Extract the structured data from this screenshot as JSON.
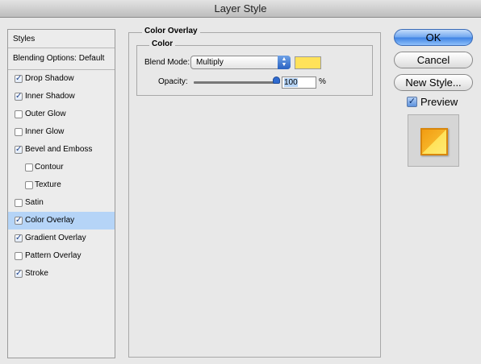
{
  "window": {
    "title": "Layer Style"
  },
  "sidebar": {
    "header": "Styles",
    "blending_options": "Blending Options: Default",
    "items": [
      {
        "label": "Drop Shadow",
        "checked": true,
        "indent": false,
        "selected": false
      },
      {
        "label": "Inner Shadow",
        "checked": true,
        "indent": false,
        "selected": false
      },
      {
        "label": "Outer Glow",
        "checked": false,
        "indent": false,
        "selected": false
      },
      {
        "label": "Inner Glow",
        "checked": false,
        "indent": false,
        "selected": false
      },
      {
        "label": "Bevel and Emboss",
        "checked": true,
        "indent": false,
        "selected": false
      },
      {
        "label": "Contour",
        "checked": false,
        "indent": true,
        "selected": false
      },
      {
        "label": "Texture",
        "checked": false,
        "indent": true,
        "selected": false
      },
      {
        "label": "Satin",
        "checked": false,
        "indent": false,
        "selected": false
      },
      {
        "label": "Color Overlay",
        "checked": true,
        "indent": false,
        "selected": true
      },
      {
        "label": "Gradient Overlay",
        "checked": true,
        "indent": false,
        "selected": false
      },
      {
        "label": "Pattern Overlay",
        "checked": false,
        "indent": false,
        "selected": false
      },
      {
        "label": "Stroke",
        "checked": true,
        "indent": false,
        "selected": false
      }
    ]
  },
  "panel": {
    "title": "Color Overlay",
    "group_title": "Color",
    "blend_mode_label": "Blend Mode:",
    "blend_mode_value": "Multiply",
    "overlay_color": "#ffe25a",
    "opacity_label": "Opacity:",
    "opacity_value": "100",
    "opacity_unit": "%",
    "opacity_fraction": 1.0
  },
  "buttons": {
    "ok": "OK",
    "cancel": "Cancel",
    "new_style": "New Style..."
  },
  "preview": {
    "label": "Preview",
    "checked": true
  }
}
